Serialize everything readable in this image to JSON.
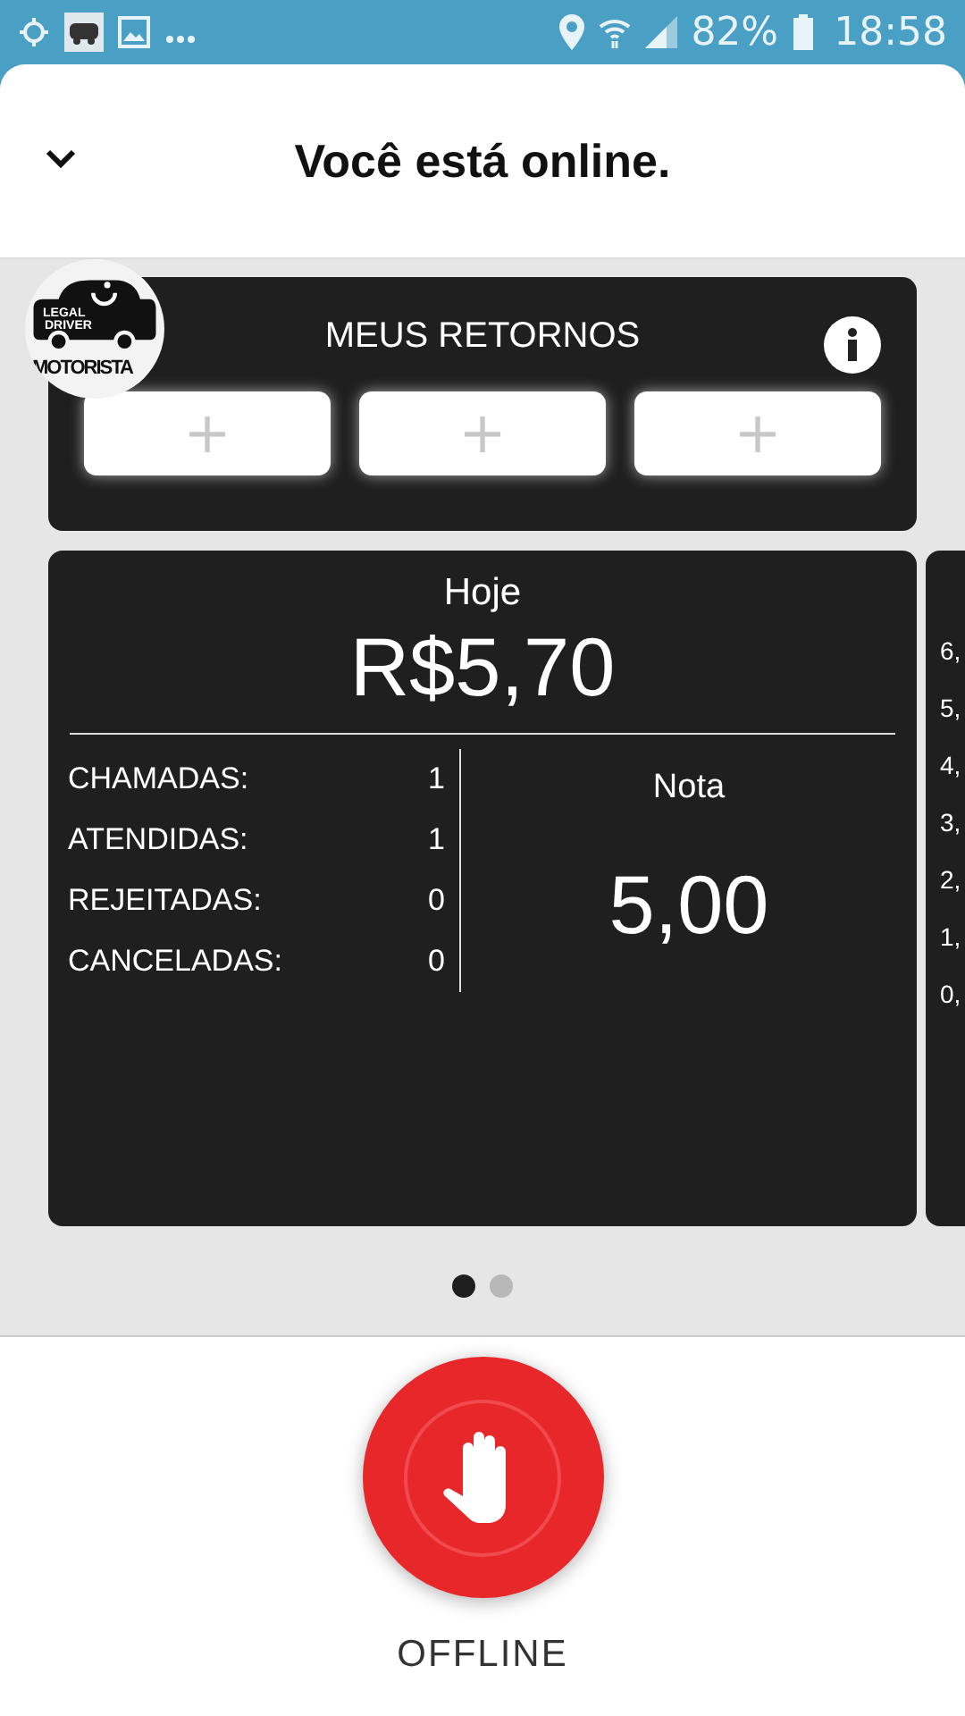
{
  "status_bar": {
    "battery": "82%",
    "time": "18:58"
  },
  "header": {
    "title": "Você está online."
  },
  "logo": {
    "line_1": "LEGAL",
    "line_2": "DRIVER",
    "caption": "MOTORISTA"
  },
  "returns": {
    "title": "MEUS RETORNOS",
    "slots": [
      "+",
      "+",
      "+"
    ]
  },
  "today": {
    "title": "Hoje",
    "amount": "R$5,70",
    "stats": [
      {
        "label": "CHAMADAS:",
        "value": "1"
      },
      {
        "label": "ATENDIDAS:",
        "value": "1"
      },
      {
        "label": "REJEITADAS:",
        "value": "0"
      },
      {
        "label": "CANCELADAS:",
        "value": "0"
      }
    ],
    "rating_label": "Nota",
    "rating": "5,00"
  },
  "next_card": {
    "axis_labels": [
      "6,",
      "5,",
      "4,",
      "3,",
      "2,",
      "1,",
      "0,"
    ]
  },
  "pager": [
    {
      "selected": true
    },
    {
      "selected": false
    }
  ],
  "offline_button": {
    "label": "OFFLINE"
  }
}
